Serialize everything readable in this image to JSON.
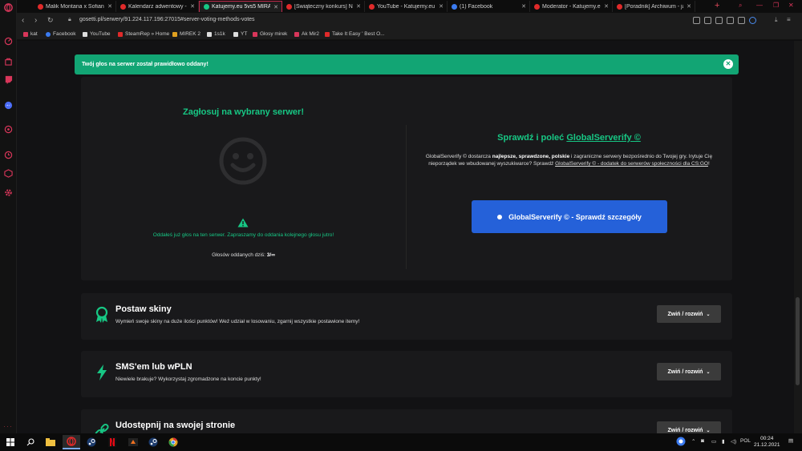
{
  "browser": {
    "tabs": [
      {
        "label": "Malik Montana x Sofiane - ",
        "favicon_color": "#e02a2a"
      },
      {
        "label": "Kalendarz adwentowy - dz",
        "favicon_color": "#e02a2a"
      },
      {
        "label": "Katujemy.eu 5vs5 MIRAGE",
        "favicon_color": "#17c784",
        "active": true
      },
      {
        "label": "[Świąteczny konkurs] Najle",
        "favicon_color": "#e02a2a"
      },
      {
        "label": "YouTube - Katujemy.eu - Sz",
        "favicon_color": "#e02a2a"
      },
      {
        "label": "(1) Facebook",
        "favicon_color": "#3b7bf0"
      },
      {
        "label": "Moderator - Katujemy.eu - ",
        "favicon_color": "#e02a2a"
      },
      {
        "label": "[Poradnik] Archiwum - jaki",
        "favicon_color": "#e02a2a"
      }
    ],
    "url": "gosetti.pl/serwery/91.224.117.196:27015#server-voting-methods-votes",
    "bookmarks": [
      {
        "label": "kat",
        "color": "#d8365a"
      },
      {
        "label": "Facebook",
        "color": "#3b7bf0"
      },
      {
        "label": "YouTube",
        "color": "#dddddd"
      },
      {
        "label": "SteamRep » Home",
        "color": "#e02a2a"
      },
      {
        "label": "MIREK 2",
        "color": "#e0a020"
      },
      {
        "label": "1s1k",
        "color": "#dddddd"
      },
      {
        "label": "YT",
        "color": "#dddddd"
      },
      {
        "label": "Głosy mirek",
        "color": "#d8365a"
      },
      {
        "label": "Ak Mir2",
        "color": "#d8365a"
      },
      {
        "label": "Take It Easy ' Best O...",
        "color": "#e02a2a"
      }
    ]
  },
  "alert": {
    "text": "Twój głos na serwer został prawidłowo oddany!",
    "close_glyph": "✕"
  },
  "vote": {
    "left_title": "Zagłosuj na wybrany serwer!",
    "voted_message": "Oddałeś już głos na ten serwer. Zapraszamy do oddania kolejnego głosu jutro!",
    "votes_label": "Głosów oddanych dziś:",
    "votes_value": "3/∞",
    "right_title_prefix": "Sprawdź i poleć",
    "right_title_link": "GlobalServerify ©",
    "desc_1": "GlobalServerify © dostarcza",
    "desc_bold": "najlepsze, sprawdzone, polskie",
    "desc_2": "i zagraniczne serwery bezpośrednio do Twojej gry. Irytuje Cię nieporządek we wbudowanej wyszukiwarce? Sprawdź",
    "desc_link": "GlobalServerify © - dodatek do serwerów społeczności dla CS:GO",
    "desc_end": "!",
    "button_label": "GlobalServerify © - Sprawdź szczegóły"
  },
  "sections": [
    {
      "title": "Postaw skiny",
      "desc": "Wymień swoje skiny na duże ilości punktów! Weź udział w losowaniu, zgarnij wszystkie postawione itemy!",
      "button": "Zwiń / rozwiń",
      "icon": "award-icon"
    },
    {
      "title": "SMS'em lub wPLN",
      "desc": "Niewiele brakuje? Wykorzystaj zgromadzone na koncie punkty!",
      "button": "Zwiń / rozwiń",
      "icon": "lightning-icon"
    },
    {
      "title": "Udostępnij na swojej stronie",
      "desc": "",
      "button": "Zwiń / rozwiń",
      "icon": "link-icon"
    }
  ],
  "taskbar": {
    "language": "POL",
    "time": "00:24",
    "date": "21.12.2021"
  },
  "colors": {
    "accent_green": "#17c784",
    "alert_green": "#12a574",
    "button_blue": "#2561d9",
    "opera_red": "#d8365a"
  }
}
